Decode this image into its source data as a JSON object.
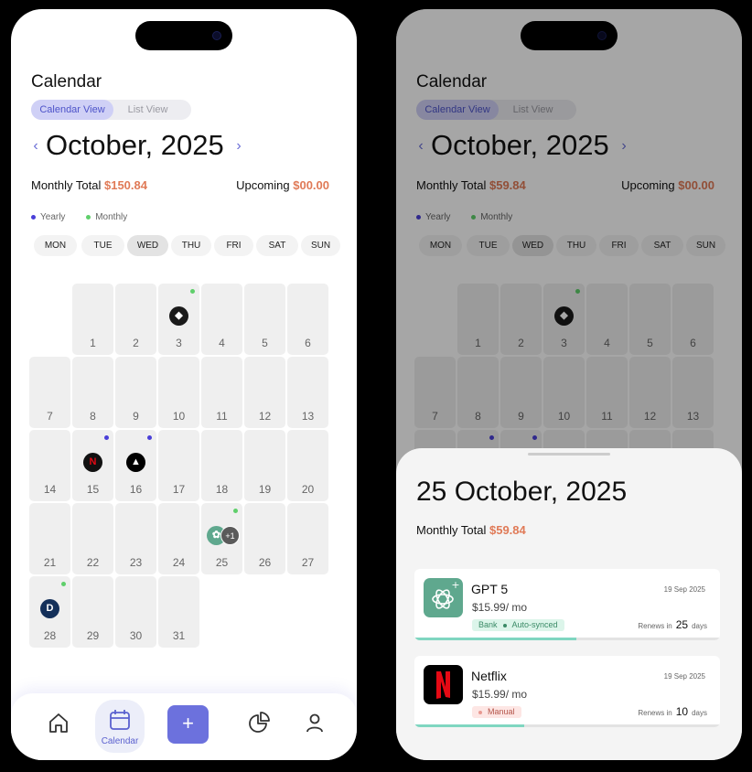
{
  "screen": {
    "title": "Calendar",
    "view_toggle": {
      "calendar": "Calendar View",
      "list": "List View"
    },
    "month_label": "October, 2025",
    "weekdays": [
      "MON",
      "TUE",
      "WED",
      "THU",
      "FRI",
      "SAT",
      "SUN"
    ],
    "selected_weekday": "WED",
    "legend": [
      {
        "label": "Yearly",
        "color": "#4a3fd8"
      },
      {
        "label": "Monthly",
        "color": "#5fcf6b"
      }
    ],
    "days": [
      "1",
      "2",
      "3",
      "4",
      "5",
      "6",
      "7",
      "8",
      "9",
      "10",
      "11",
      "12",
      "13",
      "14",
      "15",
      "16",
      "17",
      "18",
      "19",
      "20",
      "21",
      "22",
      "23",
      "24",
      "25",
      "26",
      "27",
      "28",
      "29",
      "30",
      "31"
    ],
    "subscription_day_markers": [
      {
        "day": "3",
        "marker": "monthly",
        "logo": "claude-icon"
      },
      {
        "day": "15",
        "marker": "yearly",
        "logo": "netflix-icon"
      },
      {
        "day": "16",
        "marker": "yearly",
        "logo": "triangle-icon"
      },
      {
        "day": "25",
        "marker": "monthly",
        "logo": "gpt-icon",
        "extra": "+1"
      },
      {
        "day": "28",
        "marker": "monthly",
        "logo": "disney-icon"
      }
    ],
    "nav": {
      "calendar_label": "Calendar",
      "add_label": "+"
    }
  },
  "left": {
    "monthly_total_label": "Monthly Total",
    "monthly_total_value": "$150.84",
    "upcoming_label": "Upcoming",
    "upcoming_value": "$00.00"
  },
  "right": {
    "monthly_total_label": "Monthly Total",
    "monthly_total_value": "$59.84",
    "upcoming_label": "Upcoming",
    "upcoming_value": "$00.00",
    "sheet": {
      "date": "25 October, 2025",
      "monthly_total_label": "Monthly Total",
      "monthly_total_value": "$59.84",
      "subscriptions": [
        {
          "name": "GPT 5",
          "price": "$15.99/ mo",
          "date": "19 Sep 2025",
          "tags": [
            "Bank",
            "Auto-synced"
          ],
          "renews_prefix": "Renews in",
          "renews_days": "25",
          "renews_suffix": "days",
          "progress": 0.53
        },
        {
          "name": "Netflix",
          "price": "$15.99/ mo",
          "date": "19 Sep 2025",
          "tags": [
            "Manual"
          ],
          "renews_prefix": "Renews in",
          "renews_days": "10",
          "renews_suffix": "days",
          "progress": 0.36
        }
      ]
    }
  }
}
